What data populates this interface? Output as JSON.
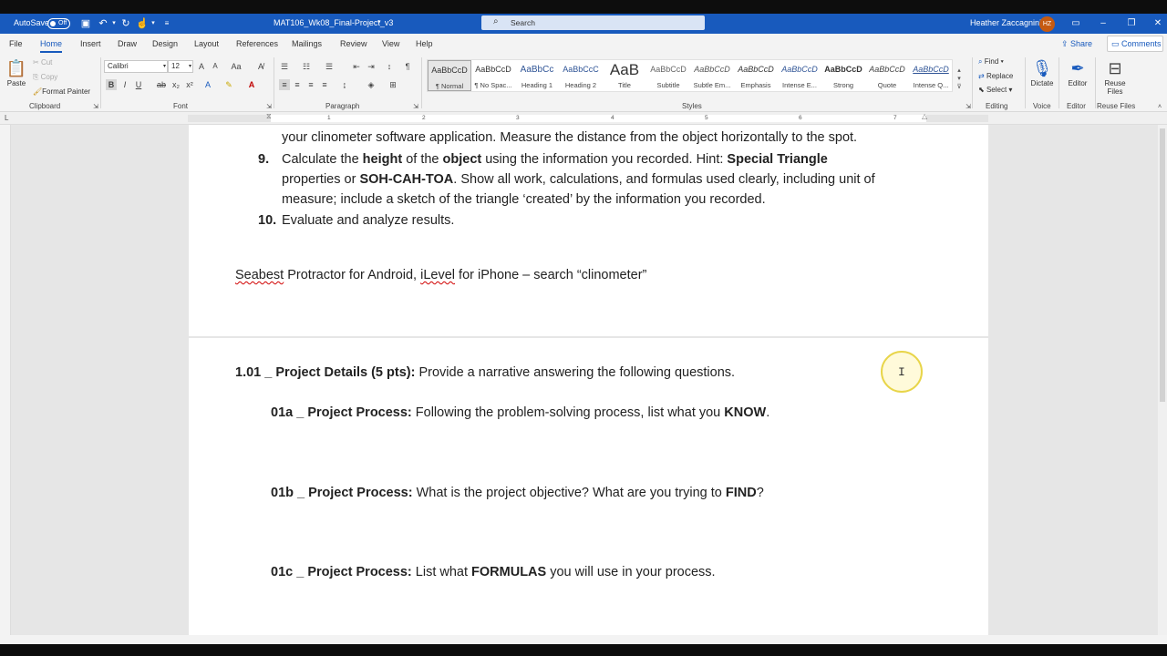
{
  "titlebar": {
    "autosave_label": "AutoSave",
    "autosave_state": "Off",
    "doc_title": "MAT106_Wk08_Final-Project_v3",
    "search_placeholder": "Search",
    "user_name": "Heather Zaccagnini",
    "user_initials": "HZ"
  },
  "tabs": [
    "File",
    "Home",
    "Insert",
    "Draw",
    "Design",
    "Layout",
    "References",
    "Mailings",
    "Review",
    "View",
    "Help"
  ],
  "active_tab": "Home",
  "share_label": "Share",
  "comments_label": "Comments",
  "clipboard": {
    "paste": "Paste",
    "cut": "Cut",
    "copy": "Copy",
    "format_painter": "Format Painter",
    "group": "Clipboard"
  },
  "font": {
    "name": "Calibri",
    "size": "12",
    "group": "Font"
  },
  "paragraph": {
    "group": "Paragraph"
  },
  "styles": {
    "group": "Styles",
    "items": [
      {
        "preview": "AaBbCcD",
        "name": "¶ Normal"
      },
      {
        "preview": "AaBbCcD",
        "name": "¶ No Spac..."
      },
      {
        "preview": "AaBbCc",
        "name": "Heading 1"
      },
      {
        "preview": "AaBbCcC",
        "name": "Heading 2"
      },
      {
        "preview": "AaB",
        "name": "Title"
      },
      {
        "preview": "AaBbCcD",
        "name": "Subtitle"
      },
      {
        "preview": "AaBbCcD",
        "name": "Subtle Em..."
      },
      {
        "preview": "AaBbCcD",
        "name": "Emphasis"
      },
      {
        "preview": "AaBbCcD",
        "name": "Intense E..."
      },
      {
        "preview": "AaBbCcD",
        "name": "Strong"
      },
      {
        "preview": "AaBbCcD",
        "name": "Quote"
      },
      {
        "preview": "AaBbCcD",
        "name": "Intense Q..."
      }
    ]
  },
  "editing": {
    "find": "Find",
    "replace": "Replace",
    "select": "Select",
    "group": "Editing"
  },
  "voice": {
    "dictate": "Dictate",
    "group": "Voice"
  },
  "editor": {
    "label": "Editor",
    "group": "Editor"
  },
  "reuse": {
    "label1": "Reuse",
    "label2": "Files",
    "group": "Reuse Files"
  },
  "ruler_numbers": [
    "1",
    "2",
    "3",
    "4",
    "5",
    "6",
    "7"
  ],
  "document": {
    "line_cont": "your clinometer software application.  Measure the distance from the object horizontally to the spot.",
    "item9_num": "9.",
    "item9_a": "Calculate the ",
    "item9_b": "height",
    "item9_c": " of the ",
    "item9_d": "object",
    "item9_e": " using the information you recorded.  Hint:  ",
    "item9_f": "Special Triangle",
    "item9_line2_a": "properties or ",
    "item9_line2_b": "SOH-CAH-TOA",
    "item9_line2_c": ".  Show all work, calculations, and formulas used clearly, including unit of",
    "item9_line3": "measure; include a sketch of the triangle ‘created’ by the information you recorded.",
    "item10_num": "10.",
    "item10_text": "Evaluate and analyze results.",
    "apps_seabest": "Seabest",
    "apps_mid": " Protractor for Android, ",
    "apps_ilevel": "iLevel",
    "apps_end": " for iPhone – search “clinometer”",
    "sec_head": "1.01 _ Project Details (5 pts):",
    "sec_text": "  Provide a narrative answering the following questions.",
    "q1_head": "01a _ Project Process:",
    "q1_text": "  Following the problem-solving process, list what you ",
    "q1_key": "KNOW",
    "q1_end": ".",
    "q2_head": "01b _ Project Process:",
    "q2_text": "  What is the project objective? What are you trying to ",
    "q2_key": "FIND",
    "q2_end": "?",
    "q3_head": "01c _ Project Process:",
    "q3_text": "  List what ",
    "q3_key": "FORMULAS",
    "q3_end": " you will use in your process."
  }
}
